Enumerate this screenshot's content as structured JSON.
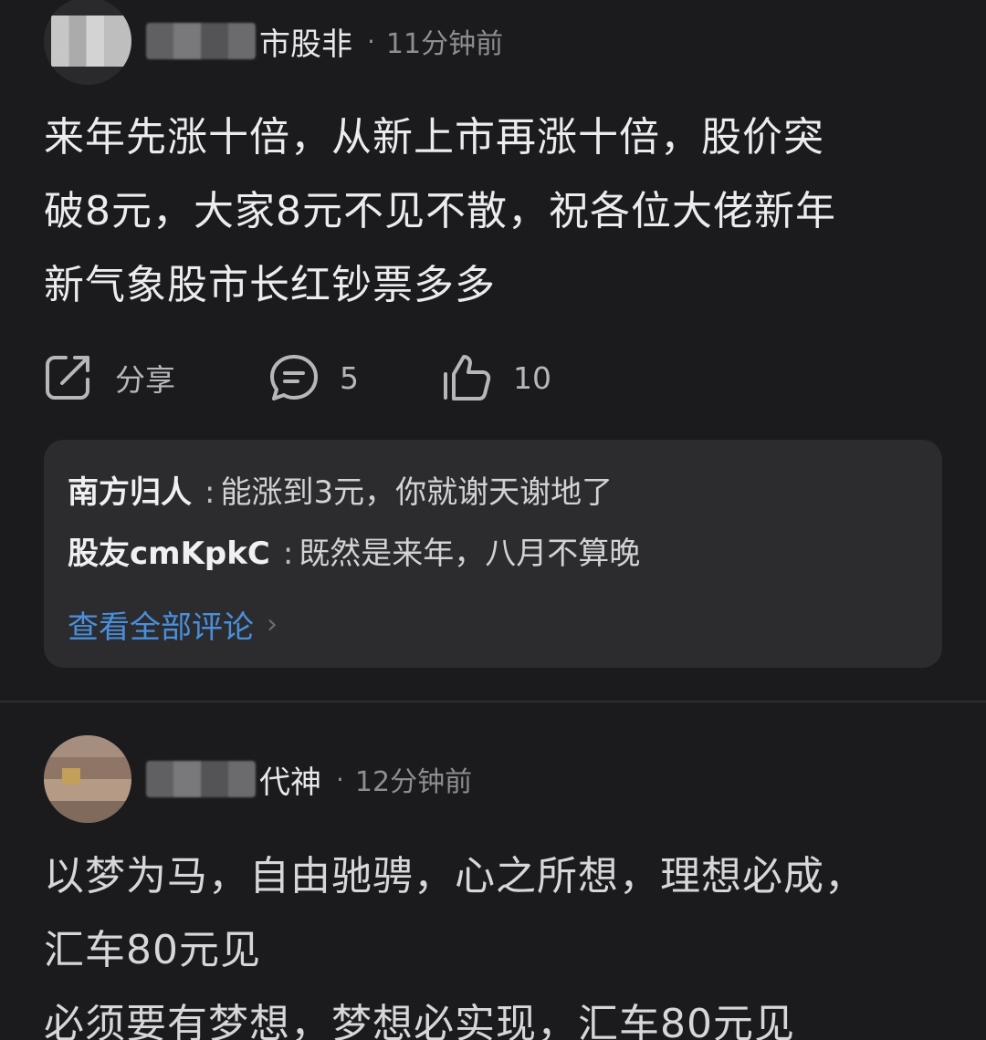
{
  "posts": [
    {
      "username_visible": "市股非",
      "separator": "·",
      "timestamp": "11分钟前",
      "content_lines": [
        "来年先涨十倍，从新上市再涨十倍，股价突",
        "破8元，大家8元不见不散，祝各位大佬新年",
        "新气象股市长红钞票多多"
      ],
      "actions": {
        "share_label": "分享",
        "comment_count": "5",
        "like_count": "10"
      },
      "replies": [
        {
          "author": "南方归人",
          "colon": ":",
          "text": "能涨到3元，你就谢天谢地了"
        },
        {
          "author": "股友cmKpkC",
          "colon": ":",
          "text": "既然是来年，八月不算晚"
        }
      ],
      "view_all_label": "查看全部评论",
      "view_all_chevron": "›"
    },
    {
      "username_visible": "代神",
      "separator": "·",
      "timestamp": "12分钟前",
      "content_lines": [
        "以梦为马，自由驰骋，心之所想，理想必成，",
        "汇车80元见",
        "必须要有梦想，梦想必实现，汇车80元见"
      ]
    }
  ],
  "icons": {
    "share": "share-icon",
    "comment": "comment-icon",
    "like": "thumbs-up-icon",
    "chevron": "chevron-right-icon"
  },
  "colors": {
    "background": "#1b1b1d",
    "reply_box": "#2c2c2f",
    "link": "#4a8fdc",
    "muted": "#8d8d92"
  }
}
